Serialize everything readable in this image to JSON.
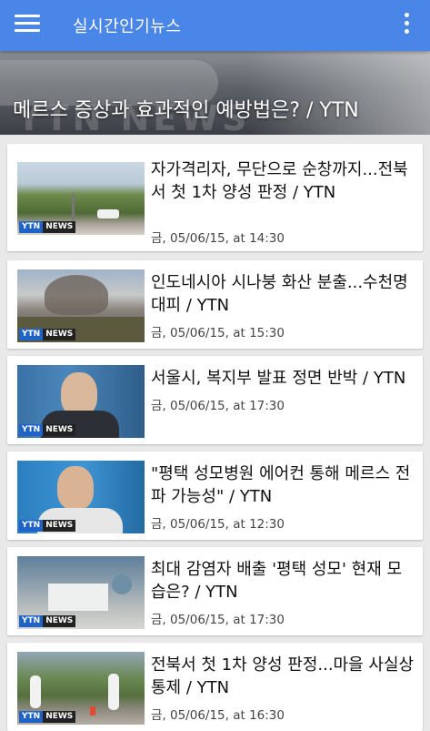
{
  "appbar": {
    "title": "실시간인기뉴스",
    "menu_icon": "menu-icon",
    "overflow_icon": "more-vert-icon",
    "color": "#4a86e8"
  },
  "hero": {
    "title": "메르스 증상과 효과적인 예방법은? / YTN",
    "watermark": "YTN NEWS"
  },
  "articles": [
    {
      "title": "자가격리자, 무단으로 순창까지...전북서 첫 1차 양성 판정 / YTN",
      "meta": "금, 05/06/15, at 14:30"
    },
    {
      "title": "인도네시아 시나붕 화산 분출...수천명 대피 / YTN",
      "meta": "금, 05/06/15, at 15:30"
    },
    {
      "title": "서울시, 복지부 발표 정면 반박 / YTN",
      "meta": "금, 05/06/15, at 17:30"
    },
    {
      "title": "\"평택 성모병원 에어컨 통해 메르스 전파 가능성\" / YTN",
      "meta": "금, 05/06/15, at 12:30"
    },
    {
      "title": "최대 감염자 배출 '평택 성모' 현재 모습은? / YTN",
      "meta": "금, 05/06/15, at 17:30"
    },
    {
      "title": "전북서 첫 1차 양성 판정...마을 사실상 통제 / YTN",
      "meta": "금, 05/06/15, at 16:30"
    }
  ],
  "thumb_logo": {
    "ytn": "YTN",
    "news": "NEWS"
  }
}
